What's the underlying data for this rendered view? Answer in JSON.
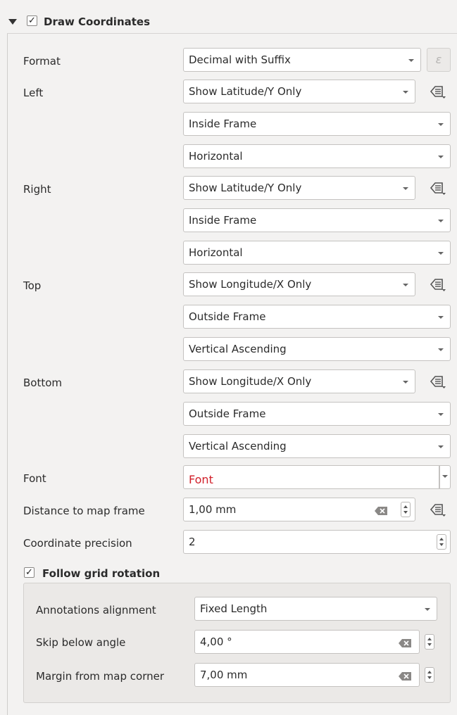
{
  "group": {
    "title": "Draw Coordinates",
    "checked_mark": "✓",
    "expand_icon": "triangle-down-icon"
  },
  "format": {
    "label": "Format",
    "value": "Decimal with Suffix",
    "expression_button": "ε"
  },
  "sides": [
    {
      "label": "Left",
      "display": "Show Latitude/Y Only",
      "position": "Inside Frame",
      "direction": "Horizontal"
    },
    {
      "label": "Right",
      "display": "Show Latitude/Y Only",
      "position": "Inside Frame",
      "direction": "Horizontal"
    },
    {
      "label": "Top",
      "display": "Show Longitude/X Only",
      "position": "Outside Frame",
      "direction": "Vertical Ascending"
    },
    {
      "label": "Bottom",
      "display": "Show Longitude/X Only",
      "position": "Outside Frame",
      "direction": "Vertical Ascending"
    }
  ],
  "font": {
    "label": "Font",
    "value": "Font"
  },
  "distance": {
    "label": "Distance to map frame",
    "value": "1,00 mm"
  },
  "precision": {
    "label": "Coordinate precision",
    "value": "2"
  },
  "follow_rotation": {
    "label": "Follow grid rotation",
    "checked_mark": "✓",
    "alignment_label": "Annotations alignment",
    "alignment_value": "Fixed Length",
    "skip_label": "Skip below angle",
    "skip_value": "4,00 °",
    "margin_label": "Margin from map corner",
    "margin_value": "7,00 mm"
  },
  "colors": {
    "background": "#f3f2f1",
    "font_preview": "#d1202a"
  }
}
